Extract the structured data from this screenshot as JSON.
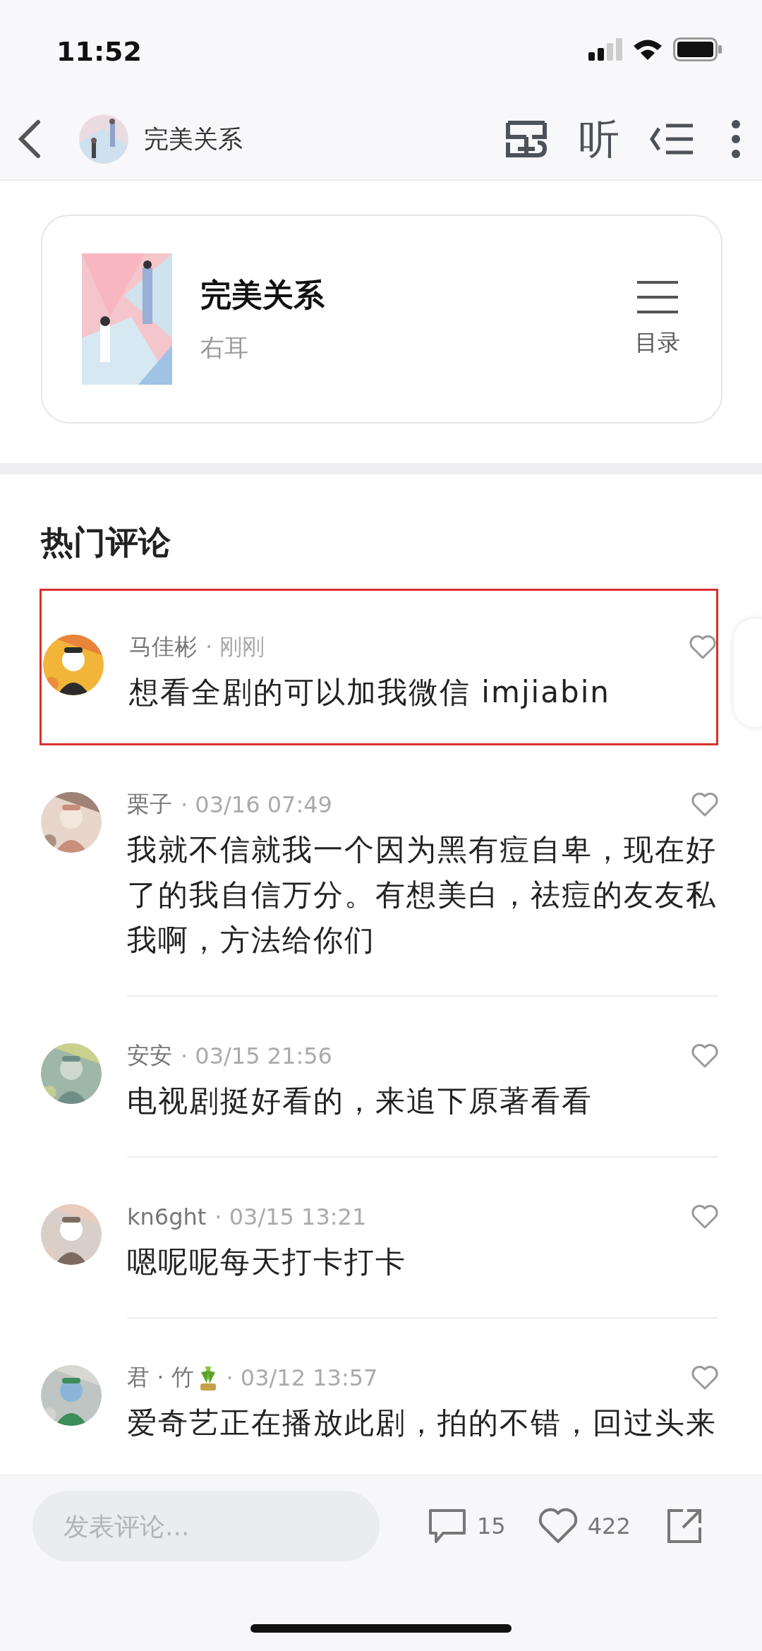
{
  "status_bar": {
    "time": "11:52"
  },
  "nav": {
    "title": "完美关系",
    "listen": "听"
  },
  "book": {
    "title": "完美关系",
    "author": "右耳",
    "toc_label": "目录"
  },
  "section_title": "热门评论",
  "comments": [
    {
      "user": "马佳彬",
      "badge": false,
      "time": "· 刚刚",
      "text": "想看全剧的可以加我微信 imjiabin",
      "highlighted": true,
      "liked": false
    },
    {
      "user": "栗子",
      "badge": false,
      "time": "· 03/16 07:49",
      "text": "我就不信就我一个因为黑有痘自卑，现在好了的我自信万分。有想美白，祛痘的友友私我啊，方法给你们",
      "highlighted": false,
      "liked": false
    },
    {
      "user": "安安",
      "badge": false,
      "time": "· 03/15 21:56",
      "text": "电视剧挺好看的，来追下原著看看",
      "highlighted": false,
      "liked": false
    },
    {
      "user": "kn6ght",
      "badge": false,
      "time": "· 03/15 13:21",
      "text": "嗯呢呢每天打卡打卡",
      "highlighted": false,
      "liked": false
    },
    {
      "user": "君 · 竹",
      "badge": true,
      "time": "· 03/12 13:57",
      "text": "爱奇艺正在播放此剧，拍的不错，回过头来",
      "highlighted": false,
      "liked": false
    }
  ],
  "composer": {
    "placeholder": "发表评论..."
  },
  "actions": {
    "comment_count": "15",
    "like_count": "422"
  }
}
